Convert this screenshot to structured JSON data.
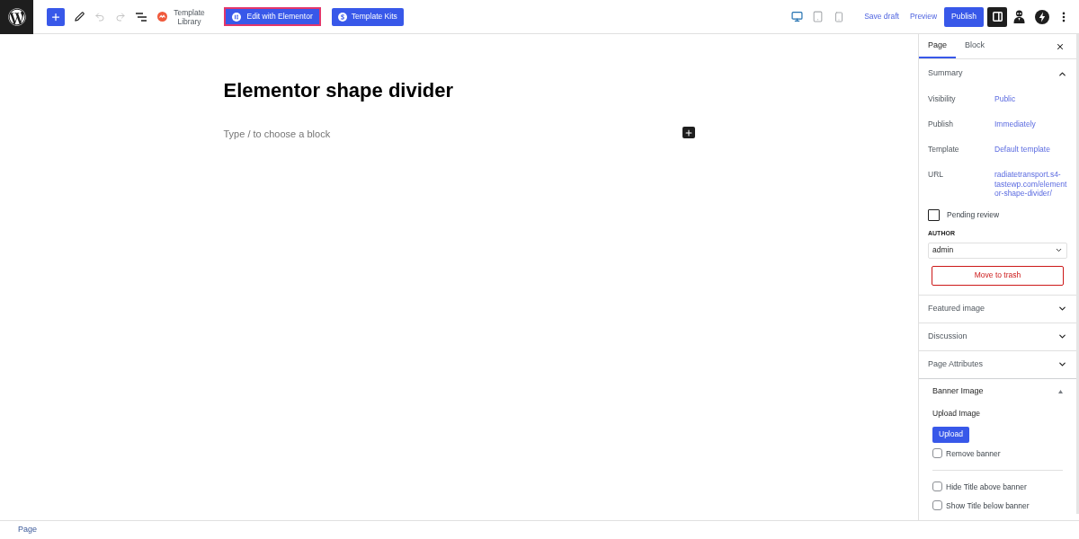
{
  "toolbar": {
    "tools": [
      {
        "kind": "inserter",
        "disabled": false
      },
      {
        "kind": "tools",
        "disabled": false
      },
      {
        "kind": "undo",
        "disabled": true
      },
      {
        "kind": "redo",
        "disabled": true
      },
      {
        "kind": "list_view",
        "disabled": false
      }
    ],
    "template_library": "Template Library",
    "edit_button": {
      "label": "Edit with Elementor",
      "highlighted": true
    },
    "kits_button": "Template Kits",
    "devices": [
      {
        "kind": "desktop",
        "selected": true
      },
      {
        "kind": "tablet",
        "selected": false
      },
      {
        "kind": "mobile",
        "selected": false
      }
    ],
    "save_draft": "Save draft",
    "preview": "Preview",
    "publish": "Publish",
    "settings_toggle": {
      "pressed": true
    }
  },
  "editor": {
    "title": "Elementor shape divider",
    "placeholder": "Type / to choose a block"
  },
  "sidebar": {
    "tabs": [
      {
        "label": "Page",
        "selected": true
      },
      {
        "label": "Block",
        "selected": false
      }
    ],
    "summary": {
      "title": "Summary",
      "expanded": true,
      "rows": [
        {
          "label": "Visibility",
          "value": "Public"
        },
        {
          "label": "Publish",
          "value": "Immediately"
        },
        {
          "label": "Template",
          "value": "Default template"
        },
        {
          "label": "URL",
          "value": "radiatetransport.s4-tastewp.com/elementor-shape-divider/"
        }
      ],
      "pending_review": {
        "label": "Pending review",
        "checked": false
      },
      "author": {
        "label": "AUTHOR",
        "value": "admin"
      },
      "trash_button": "Move to trash"
    },
    "panels": [
      {
        "title": "Featured image",
        "expanded": false
      },
      {
        "title": "Discussion",
        "expanded": false
      },
      {
        "title": "Page Attributes",
        "expanded": false
      }
    ],
    "banner": {
      "title": "Banner Image",
      "expanded": true,
      "upload_label": "Upload Image",
      "upload_button": "Upload",
      "remove_banner": {
        "label": "Remove banner",
        "checked": false
      },
      "title_options": [
        {
          "label": "Hide Title above banner",
          "checked": false
        },
        {
          "label": "Show Title below banner",
          "checked": false
        }
      ]
    }
  },
  "footer": {
    "breadcrumb": "Page"
  }
}
